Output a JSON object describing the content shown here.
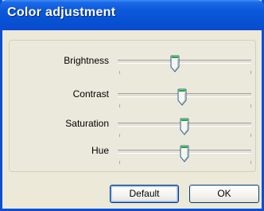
{
  "window": {
    "title": "Color adjustment"
  },
  "sliders": [
    {
      "label": "Brightness",
      "level": 0.42
    },
    {
      "label": "Contrast",
      "level": 0.48
    },
    {
      "label": "Saturation",
      "level": 0.5
    },
    {
      "label": "Hue",
      "level": 0.5
    }
  ],
  "buttons": {
    "default_label": "Default",
    "ok_label": "OK"
  },
  "colors": {
    "title_bar": "#0752d2",
    "thumb_accent": "#1db023",
    "dialog_bg": "#ece9d8"
  }
}
